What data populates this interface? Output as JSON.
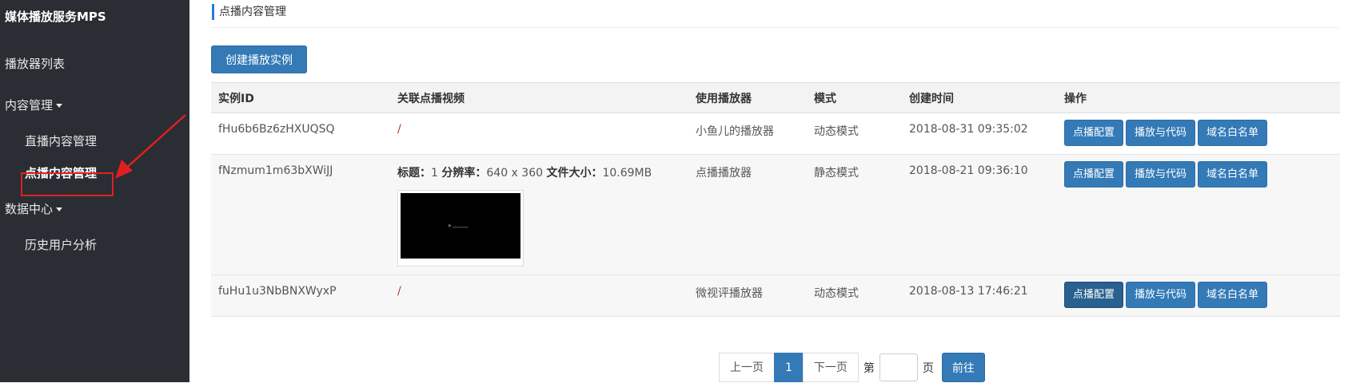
{
  "sidebar": {
    "brand": "媒体播放服务MPS",
    "items": [
      {
        "label": "播放器列表"
      },
      {
        "label": "内容管理"
      },
      {
        "label": "数据中心"
      }
    ],
    "content_sub": [
      {
        "label": "直播内容管理"
      },
      {
        "label": "点播内容管理"
      }
    ],
    "data_sub": [
      {
        "label": "历史用户分析"
      }
    ]
  },
  "main": {
    "header": "点播内容管理",
    "create_button": "创建播放实例",
    "columns": [
      "实例ID",
      "关联点播视频",
      "使用播放器",
      "模式",
      "创建时间",
      "操作"
    ],
    "rows": [
      {
        "id": "fHu6b6Bz6zHXUQSQ",
        "video": "/",
        "player": "小鱼儿的播放器",
        "mode": "动态模式",
        "created": "2018-08-31 09:35:02"
      },
      {
        "id": "fNzmum1m63bXWiJJ",
        "video_title_label": "标题：",
        "video_title": "1",
        "video_res_label": "分辨率：",
        "video_res": "640 x 360",
        "video_size_label": "文件大小：",
        "video_size": "10.69MB",
        "player": "点播播放器",
        "mode": "静态模式",
        "created": "2018-08-21 09:36:10"
      },
      {
        "id": "fuHu1u3NbBNXWyxP",
        "video": "/",
        "player": "微视评播放器",
        "mode": "动态模式",
        "created": "2018-08-13 17:46:21"
      }
    ],
    "actions": [
      "点播配置",
      "播放与代码",
      "域名白名单"
    ]
  },
  "pagination": {
    "prev": "上一页",
    "current": "1",
    "next": "下一页",
    "page_prefix": "第",
    "page_suffix": "页",
    "go": "前往"
  },
  "colors": {
    "sidebar_bg": "#2a2d33",
    "primary": "#337ab7",
    "highlight": "#e02020"
  }
}
